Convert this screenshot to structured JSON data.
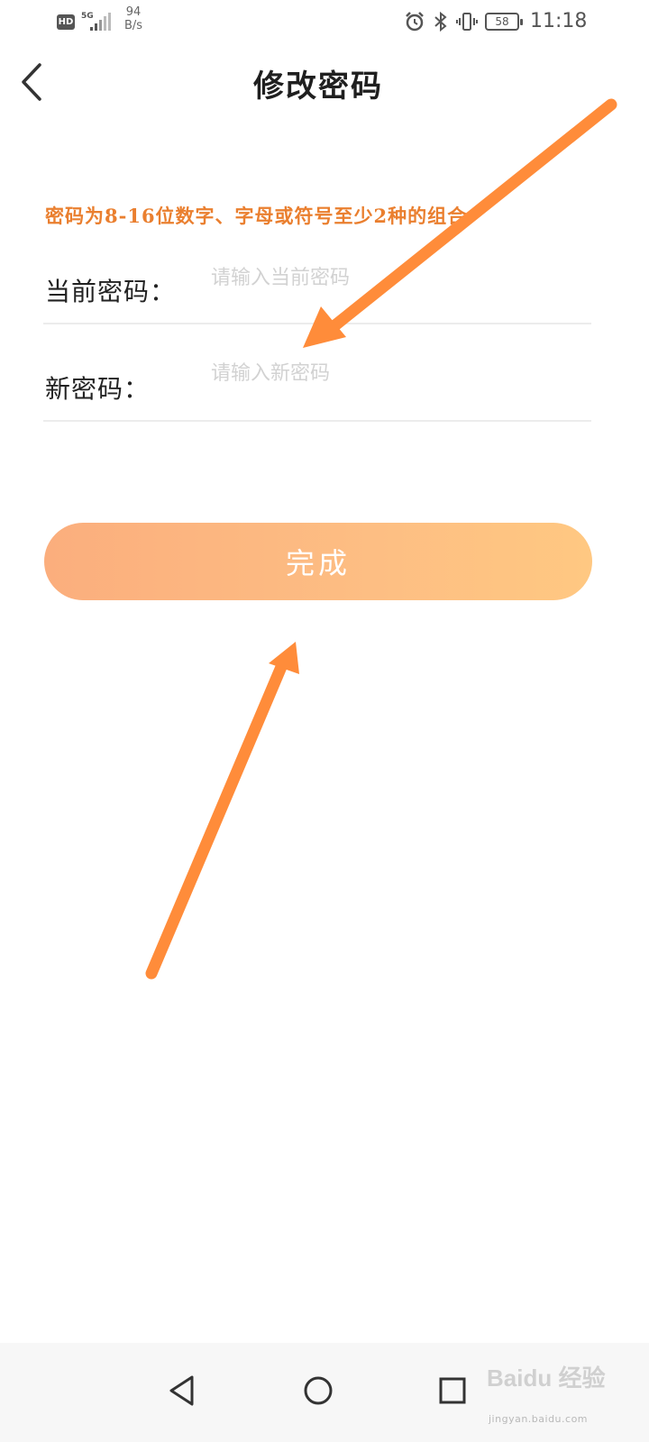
{
  "status_bar": {
    "hd": "HD",
    "network": "5G",
    "speed_value": "94",
    "speed_unit": "B/s",
    "battery": "58",
    "time": "11:18",
    "icons": [
      "alarm-icon",
      "bluetooth-icon",
      "vibrate-icon",
      "battery-icon"
    ]
  },
  "header": {
    "back_icon": "chevron-left-icon",
    "title": "修改密码"
  },
  "hint": "密码为8-16位数字、字母或符号至少2种的组合",
  "form": {
    "current": {
      "label": "当前密码：",
      "placeholder": "请输入当前密码",
      "value": ""
    },
    "new": {
      "label": "新密码：",
      "placeholder": "请输入新密码",
      "value": ""
    }
  },
  "submit_label": "完成",
  "nav": [
    "back-triangle-icon",
    "home-circle-icon",
    "recent-square-icon"
  ],
  "watermark": {
    "text": "jingyan.baidu.com",
    "logo_text": "Baidu 经验"
  },
  "colors": {
    "hint": "#ea7f2f",
    "button_start": "#fbae7d",
    "button_end": "#ffc882",
    "annotation_arrow": "#ff8c3a"
  }
}
